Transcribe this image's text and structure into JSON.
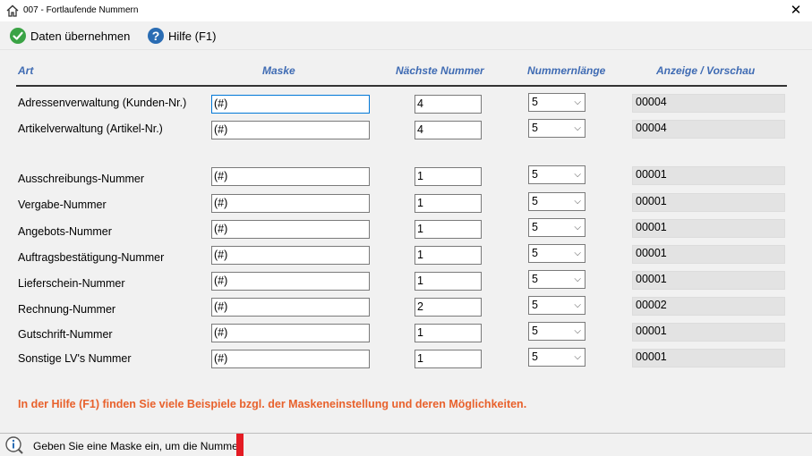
{
  "window": {
    "title": "007  -  Fortlaufende Nummern",
    "close": "✕"
  },
  "toolbar": {
    "save_label": "Daten übernehmen",
    "help_label": "Hilfe (F1)"
  },
  "columns": {
    "art": "Art",
    "maske": "Maske",
    "next": "Nächste Nummer",
    "length": "Nummernlänge",
    "preview": "Anzeige / Vorschau"
  },
  "rows": [
    {
      "label": "Adressenverwaltung (Kunden-Nr.)",
      "mask": "(#)",
      "next": "4",
      "length": "5",
      "preview": "00004"
    },
    {
      "label": "Artikelverwaltung (Artikel-Nr.)",
      "mask": "(#)",
      "next": "4",
      "length": "5",
      "preview": "00004"
    },
    {
      "label": "Ausschreibungs-Nummer",
      "mask": "(#)",
      "next": "1",
      "length": "5",
      "preview": "00001"
    },
    {
      "label": "Vergabe-Nummer",
      "mask": "(#)",
      "next": "1",
      "length": "5",
      "preview": "00001"
    },
    {
      "label": "Angebots-Nummer",
      "mask": "(#)",
      "next": "1",
      "length": "5",
      "preview": "00001"
    },
    {
      "label": "Auftragsbestätigung-Nummer",
      "mask": "(#)",
      "next": "1",
      "length": "5",
      "preview": "00001"
    },
    {
      "label": "Lieferschein-Nummer",
      "mask": "(#)",
      "next": "1",
      "length": "5",
      "preview": "00001"
    },
    {
      "label": "Rechnung-Nummer",
      "mask": "(#)",
      "next": "2",
      "length": "5",
      "preview": "00002"
    },
    {
      "label": "Gutschrift-Nummer",
      "mask": "(#)",
      "next": "1",
      "length": "5",
      "preview": "00001"
    },
    {
      "label": "Sonstige LV's Nummer",
      "mask": "(#)",
      "next": "1",
      "length": "5",
      "preview": "00001"
    }
  ],
  "hint": "In der Hilfe (F1) finden Sie viele Beispiele bzgl. der Maskeneinstellung und deren Möglichkeiten.",
  "status": {
    "text": "Geben Sie eine Maske ein, um die Nummer zu formatieren."
  },
  "icons": {
    "home": "home-icon",
    "save": "checkmark-icon",
    "help": "question-icon",
    "info": "info-icon"
  },
  "colors": {
    "header": "#3f6bb3",
    "hint": "#e8612c",
    "save_green": "#3aa345",
    "help_blue": "#2a6cb3",
    "marker": "#e41c24"
  }
}
